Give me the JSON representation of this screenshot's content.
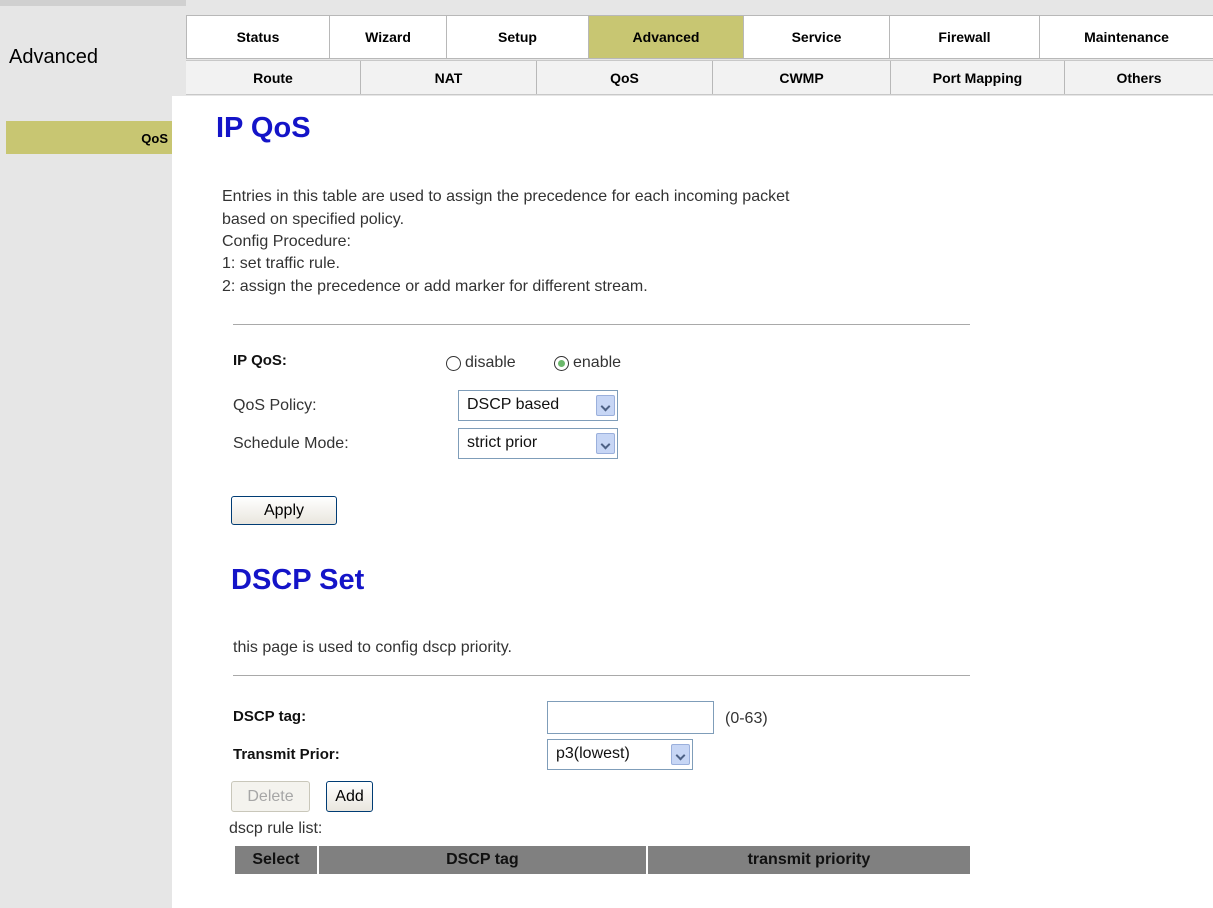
{
  "header": {
    "section_title": "Advanced",
    "main_tabs": [
      {
        "label": "Status"
      },
      {
        "label": "Wizard"
      },
      {
        "label": "Setup"
      },
      {
        "label": "Advanced",
        "active": true
      },
      {
        "label": "Service"
      },
      {
        "label": "Firewall"
      },
      {
        "label": "Maintenance"
      }
    ],
    "sub_tabs": [
      {
        "label": "Route"
      },
      {
        "label": "NAT"
      },
      {
        "label": "QoS"
      },
      {
        "label": "CWMP"
      },
      {
        "label": "Port Mapping"
      },
      {
        "label": "Others"
      }
    ]
  },
  "sidebar": {
    "items": [
      {
        "label": "QoS",
        "active": true
      }
    ]
  },
  "ipqos": {
    "title": "IP QoS",
    "description": [
      "Entries in this table are used to assign the precedence for each incoming packet",
      "based on specified policy.",
      "Config Procedure:",
      "1: set traffic rule.",
      "2: assign the precedence or add marker for different stream."
    ],
    "enable_label": "IP QoS:",
    "disable_option": "disable",
    "enable_option": "enable",
    "selected": "enable",
    "policy_label": "QoS Policy:",
    "policy_value": "DSCP based",
    "schedule_label": "Schedule Mode:",
    "schedule_value": "strict prior",
    "apply_label": "Apply"
  },
  "dscp": {
    "title": "DSCP Set",
    "description": "this page is used to config dscp priority.",
    "tag_label": "DSCP tag:",
    "tag_value": "",
    "tag_range": "(0-63)",
    "prior_label": "Transmit Prior:",
    "prior_value": "p3(lowest)",
    "delete_label": "Delete",
    "add_label": "Add",
    "list_label": "dscp rule list:",
    "columns": [
      "Select",
      "DSCP tag",
      "transmit priority"
    ]
  },
  "colors": {
    "active_tab": "#c8c672",
    "heading": "#1414c8",
    "header_bg": "#e6e6e6",
    "table_header": "#808080"
  }
}
